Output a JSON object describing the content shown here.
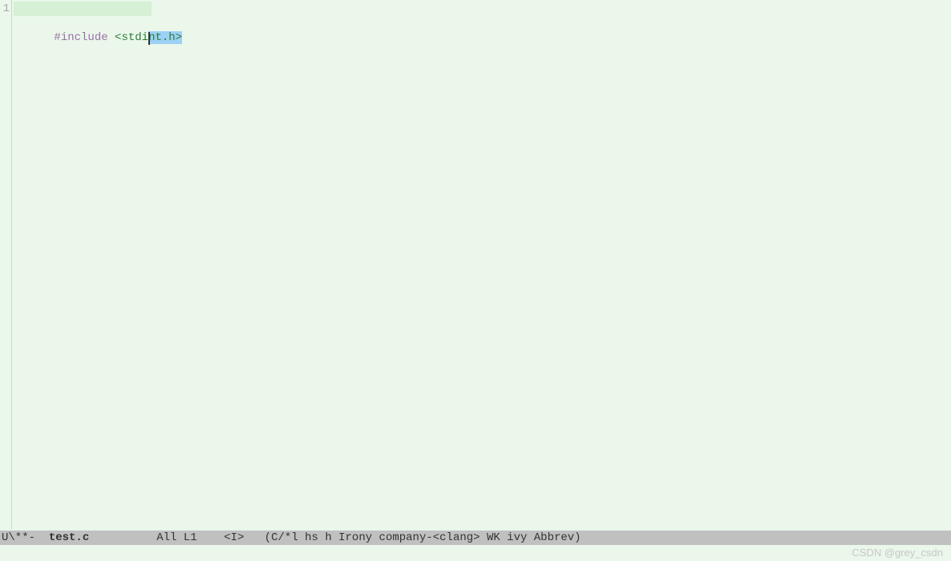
{
  "gutter": {
    "line1": "1"
  },
  "code": {
    "line1": {
      "preproc": "#include",
      "space": " ",
      "header_pre": "<stdi",
      "header_sel": "nt.h>",
      "full_header": "<stdint.h>"
    }
  },
  "highlight": {
    "width_px": "172px"
  },
  "modeline": {
    "status": "U\\**-  ",
    "filename": "test.c",
    "spacer1": "          ",
    "position": "All L1",
    "spacer2": "    ",
    "mode_indicator": "<I>",
    "spacer3": "   ",
    "modes": "(C/*l hs h Irony company-<clang> WK ivy Abbrev)"
  },
  "watermark": "CSDN @grey_csdn"
}
